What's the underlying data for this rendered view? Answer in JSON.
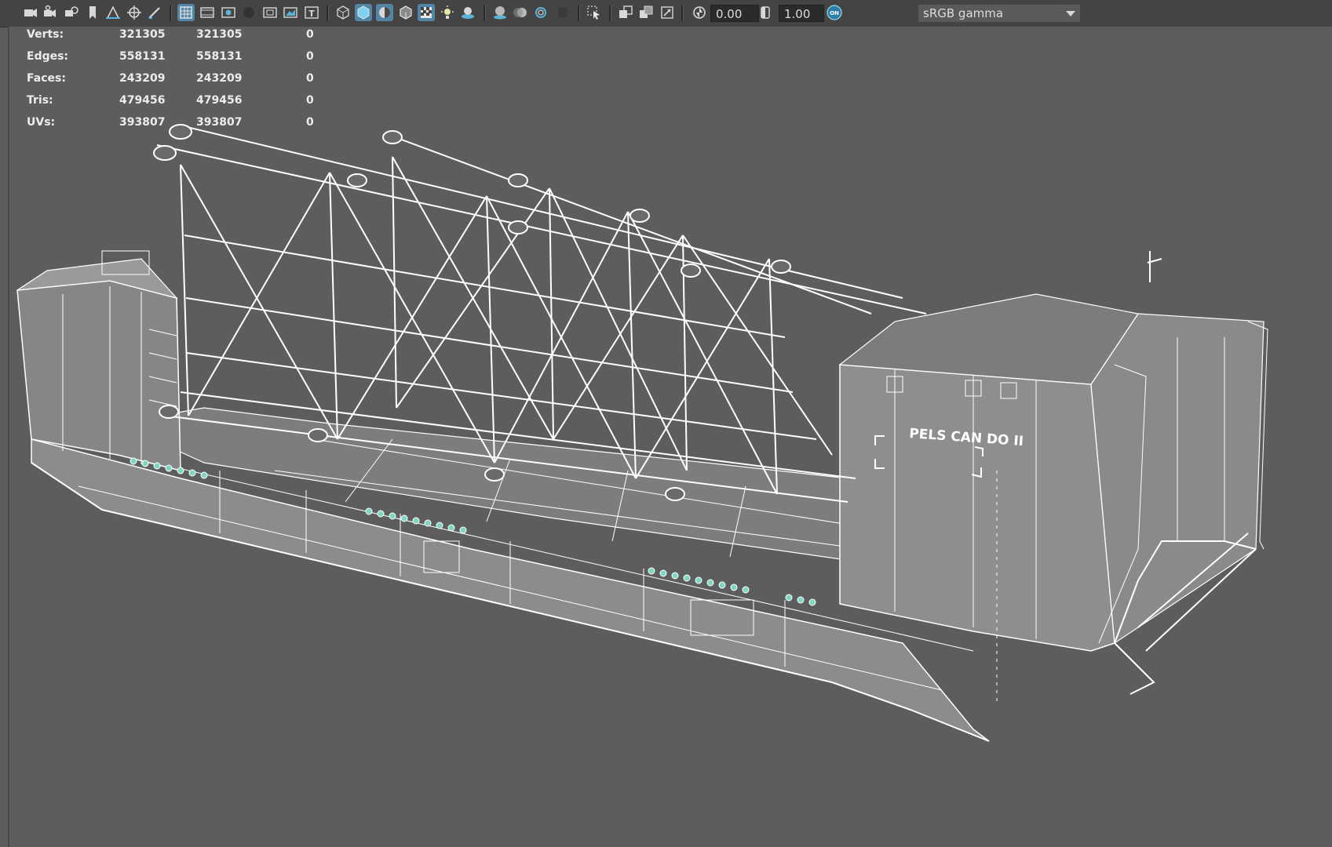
{
  "toolbar": {
    "icons": [
      "camera-icon",
      "camera-attributes-icon",
      "bookmark-icon",
      "image-plane-icon",
      "grease-pencil-icon",
      "grid-icon",
      "film-gate-icon",
      "resolution-gate-icon",
      "gate-mask-icon",
      "field-chart-icon",
      "safe-action-icon",
      "safe-title-icon",
      "wireframe-icon",
      "smooth-shade-icon",
      "default-material-icon",
      "wireframe-on-shaded-icon",
      "textured-icon",
      "use-all-lights-icon",
      "shadows-icon",
      "screen-space-ao-icon",
      "motion-blur-icon",
      "anti-aliasing-icon",
      "depth-of-field-icon",
      "isolate-select-icon",
      "xray-icon",
      "xray-joints-icon",
      "xray-active-components-icon",
      "exposure-icon",
      "gamma-icon",
      "color-management-icon",
      "colorspace-dropdown-icon"
    ],
    "exposure_value": "0.00",
    "gamma_value": "1.00",
    "colorspace_label": "sRGB gamma",
    "cm_label": "ON",
    "accent_color": "#5285a6"
  },
  "hud": {
    "rows": [
      {
        "label": "Verts:",
        "v1": "321305",
        "v2": "321305",
        "v3": "0"
      },
      {
        "label": "Edges:",
        "v1": "558131",
        "v2": "558131",
        "v3": "0"
      },
      {
        "label": "Faces:",
        "v1": "243209",
        "v2": "243209",
        "v3": "0"
      },
      {
        "label": "Tris:",
        "v1": "479456",
        "v2": "479456",
        "v3": "0"
      },
      {
        "label": "UVs:",
        "v1": "393807",
        "v2": "393807",
        "v3": "0"
      }
    ]
  },
  "scene": {
    "hull_text": "PELS CAN DO II",
    "wire_color": "#ffffff",
    "hull_color": "#8a8a8a",
    "bg_color": "#5d5d5d",
    "marker_color": "#7fd6c2"
  }
}
